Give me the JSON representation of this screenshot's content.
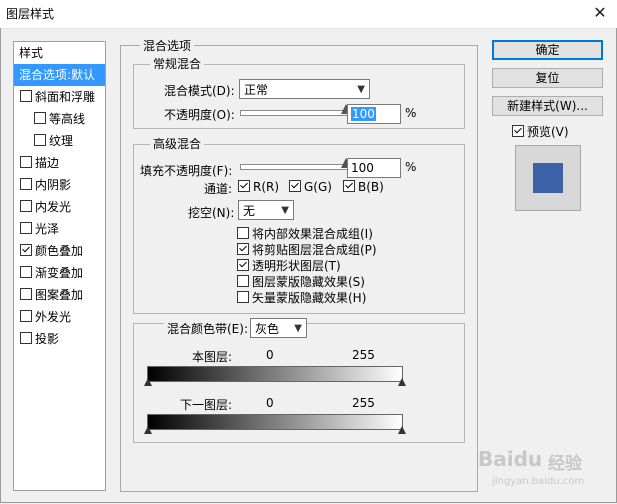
{
  "window": {
    "title": "图层样式",
    "close_glyph": "✕"
  },
  "sidebar": {
    "header": "样式",
    "items": [
      {
        "label": "混合选项:默认",
        "checkbox": false,
        "checked": false,
        "selected": true
      },
      {
        "label": "斜面和浮雕",
        "checkbox": true,
        "checked": false,
        "selected": false
      },
      {
        "label": "等高线",
        "checkbox": true,
        "checked": false,
        "selected": false,
        "indent": true
      },
      {
        "label": "纹理",
        "checkbox": true,
        "checked": false,
        "selected": false,
        "indent": true
      },
      {
        "label": "描边",
        "checkbox": true,
        "checked": false,
        "selected": false
      },
      {
        "label": "内阴影",
        "checkbox": true,
        "checked": false,
        "selected": false
      },
      {
        "label": "内发光",
        "checkbox": true,
        "checked": false,
        "selected": false
      },
      {
        "label": "光泽",
        "checkbox": true,
        "checked": false,
        "selected": false
      },
      {
        "label": "颜色叠加",
        "checkbox": true,
        "checked": true,
        "selected": false
      },
      {
        "label": "渐变叠加",
        "checkbox": true,
        "checked": false,
        "selected": false
      },
      {
        "label": "图案叠加",
        "checkbox": true,
        "checked": false,
        "selected": false
      },
      {
        "label": "外发光",
        "checkbox": true,
        "checked": false,
        "selected": false
      },
      {
        "label": "投影",
        "checkbox": true,
        "checked": false,
        "selected": false
      }
    ]
  },
  "blend_options": {
    "title": "混合选项",
    "general": {
      "title": "常规混合",
      "blend_mode_label": "混合模式(D):",
      "blend_mode_value": "正常",
      "opacity_label": "不透明度(O):",
      "opacity_value": "100",
      "opacity_fraction": 1.0,
      "percent": "%"
    },
    "advanced": {
      "title": "高级混合",
      "fill_opacity_label": "填充不透明度(F):",
      "fill_opacity_value": "100",
      "fill_opacity_fraction": 1.0,
      "percent": "%",
      "channels_label": "通道:",
      "channels": [
        {
          "label": "R(R)",
          "checked": true
        },
        {
          "label": "G(G)",
          "checked": true
        },
        {
          "label": "B(B)",
          "checked": true
        }
      ],
      "knockout_label": "挖空(N):",
      "knockout_value": "无",
      "options": [
        {
          "label": "将内部效果混合成组(I)",
          "checked": false
        },
        {
          "label": "将剪贴图层混合成组(P)",
          "checked": true
        },
        {
          "label": "透明形状图层(T)",
          "checked": true
        },
        {
          "label": "图层蒙版隐藏效果(S)",
          "checked": false
        },
        {
          "label": "矢量蒙版隐藏效果(H)",
          "checked": false
        }
      ]
    },
    "blend_if": {
      "label": "混合颜色带(E):",
      "value": "灰色",
      "this_layer": {
        "label": "本图层:",
        "min": "0",
        "max": "255"
      },
      "underlying_layer": {
        "label": "下一图层:",
        "min": "0",
        "max": "255"
      }
    }
  },
  "buttons": {
    "ok": "确定",
    "reset": "复位",
    "new_style": "新建样式(W)...",
    "preview_label": "预览(V)",
    "preview_checked": true
  },
  "preview": {
    "swatch_color": "#3b62a6"
  },
  "watermark": {
    "brand": "Baidu",
    "text": "经验",
    "url": "jingyan.baidu.com"
  }
}
